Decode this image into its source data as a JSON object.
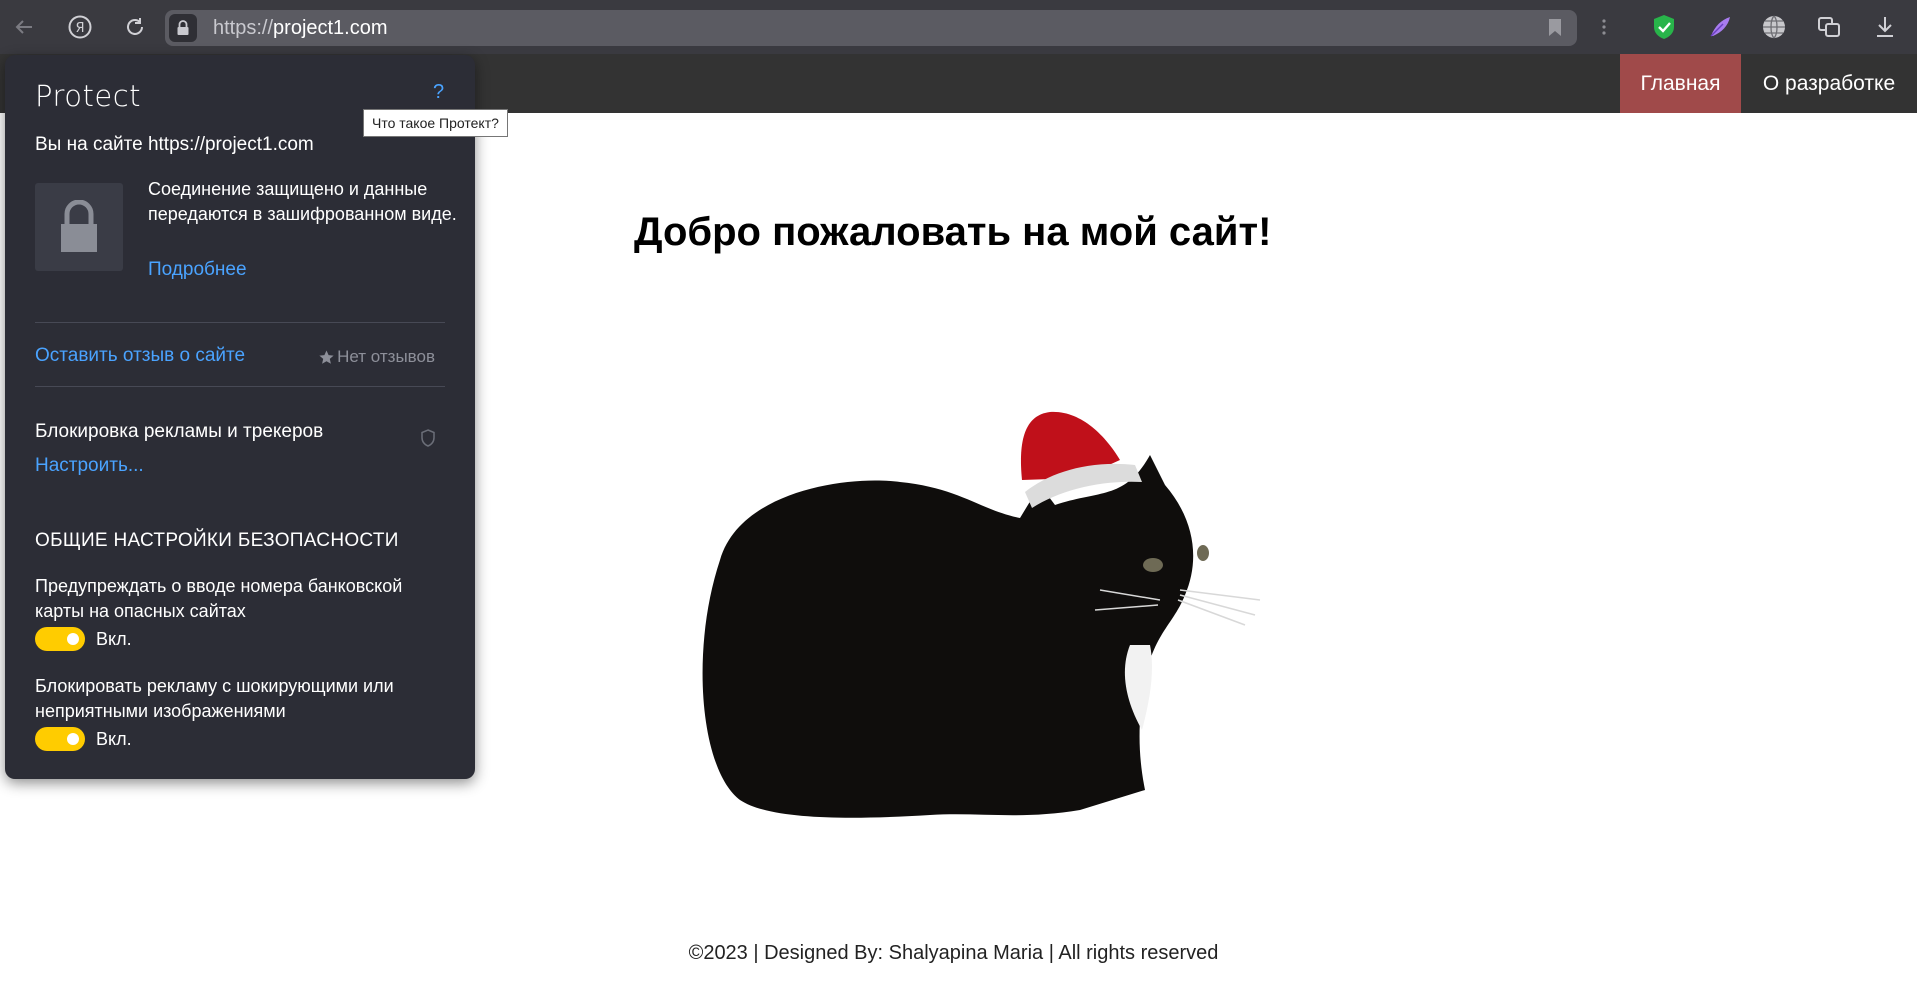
{
  "browser": {
    "url_protocol": "https://",
    "url_host": "project1.com"
  },
  "site": {
    "nav": {
      "home": "Главная",
      "about": "О разработке"
    },
    "title": "Добро пожаловать на мой сайт!",
    "footer": "©2023 | Designed By: Shalyapina Maria | All rights reserved"
  },
  "protect": {
    "logo": "Protect",
    "help": "?",
    "tooltip": "Что такое Протект?",
    "site_line": "Вы на сайте https://project1.com",
    "connection": "Соединение защищено и данные передаются в зашифрованном виде.",
    "more_link": "Подробнее",
    "review_link": "Оставить отзыв о сайте",
    "no_reviews": "Нет отзывов",
    "adblock_label": "Блокировка рекламы и трекеров",
    "setup_link": "Настроить...",
    "section_title": "ОБЩИЕ НАСТРОЙКИ БЕЗОПАСНОСТИ",
    "options": [
      {
        "label": "Предупреждать о вводе номера банковской карты на опасных сайтах",
        "state": "Вкл."
      },
      {
        "label": "Блокировать рекламу с шокирующими или неприятными изображениями",
        "state": "Вкл."
      }
    ]
  },
  "colors": {
    "accent_link": "#4aa3ff",
    "toggle_on": "#ffcc00",
    "nav_active": "#a04a4a",
    "popup_bg": "#2c2d36"
  }
}
